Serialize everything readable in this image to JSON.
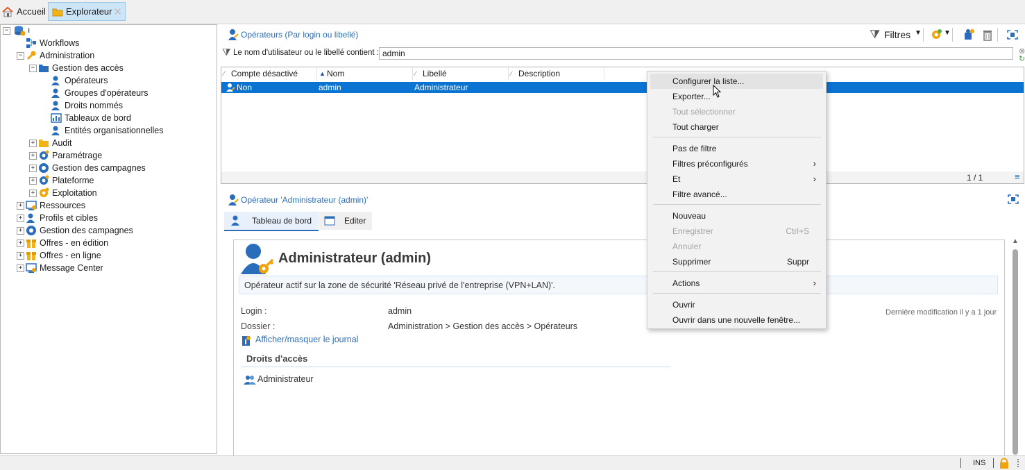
{
  "tabs": {
    "home": "Accueil",
    "explorer": "Explorateur",
    "close": "✕"
  },
  "tree": {
    "root": "ı",
    "items": [
      {
        "label": "Workflows",
        "icon": "workflow-icon"
      },
      {
        "label": "Administration",
        "icon": "wrench-icon"
      },
      {
        "label": "Gestion des accès",
        "icon": "folder-access-icon"
      },
      {
        "label": "Opérateurs",
        "icon": "operator-icon"
      },
      {
        "label": "Groupes d'opérateurs",
        "icon": "operator-group-icon"
      },
      {
        "label": "Droits nommés",
        "icon": "named-rights-icon"
      },
      {
        "label": "Tableaux de bord",
        "icon": "dashboard-icon"
      },
      {
        "label": "Entités organisationnelles",
        "icon": "org-entity-icon"
      },
      {
        "label": "Audit",
        "icon": "folder-icon"
      },
      {
        "label": "Paramétrage",
        "icon": "gears-icon"
      },
      {
        "label": "Gestion des campagnes",
        "icon": "campaign-icon"
      },
      {
        "label": "Plateforme",
        "icon": "platform-icon"
      },
      {
        "label": "Exploitation",
        "icon": "gears-orange-icon"
      },
      {
        "label": "Ressources",
        "icon": "resources-icon"
      },
      {
        "label": "Profils et cibles",
        "icon": "profiles-icon"
      },
      {
        "label": "Gestion des campagnes",
        "icon": "campaign-icon"
      },
      {
        "label": "Offres - en édition",
        "icon": "offer-icon"
      },
      {
        "label": "Offres - en ligne",
        "icon": "offer-icon"
      },
      {
        "label": "Message Center",
        "icon": "message-center-icon"
      }
    ]
  },
  "list": {
    "title": "Opérateurs (Par login ou libellé)",
    "filters_label": "Filtres",
    "filter_caption": "Le nom d'utilisateur ou le libellé contient :",
    "filter_value": "admin",
    "columns": [
      "Compte désactivé",
      "Nom",
      "Libellé",
      "Description"
    ],
    "row": {
      "disabled": "Non",
      "name": "admin",
      "label": "Administrateur"
    },
    "pagination": "1 / 1"
  },
  "detail": {
    "title": "Opérateur 'Administrateur (admin)'",
    "tab_dashboard": "Tableau de bord",
    "tab_edit": "Editer",
    "heading": "Administrateur (admin)",
    "notice": "Opérateur actif sur la zone de sécurité 'Réseau privé de l'entreprise (VPN+LAN)'.",
    "login_label": "Login :",
    "login_value": "admin",
    "folder_label": "Dossier :",
    "folder_value": "Administration > Gestion des accès > Opérateurs",
    "last_modified": "Dernière modification il y a 1 jour",
    "journal_link": "Afficher/masquer le journal",
    "rights_title": "Droits d'accès",
    "right_item": "Administrateur"
  },
  "menu": {
    "configure": "Configurer la liste...",
    "export": "Exporter...",
    "select_all": "Tout sélectionner",
    "load_all": "Tout charger",
    "no_filter": "Pas de filtre",
    "preset_filters": "Filtres préconfigurés",
    "and": "Et",
    "advanced_filter": "Filtre avancé...",
    "new": "Nouveau",
    "save": "Enregistrer",
    "save_shortcut": "Ctrl+S",
    "cancel": "Annuler",
    "delete": "Supprimer",
    "delete_shortcut": "Suppr",
    "actions": "Actions",
    "open": "Ouvrir",
    "open_new_window": "Ouvrir dans une nouvelle fenêtre..."
  },
  "status": {
    "ins": "INS"
  },
  "colors": {
    "accent": "#2a6ebb",
    "selection": "#0b73d1",
    "orange": "#f0a30a"
  }
}
